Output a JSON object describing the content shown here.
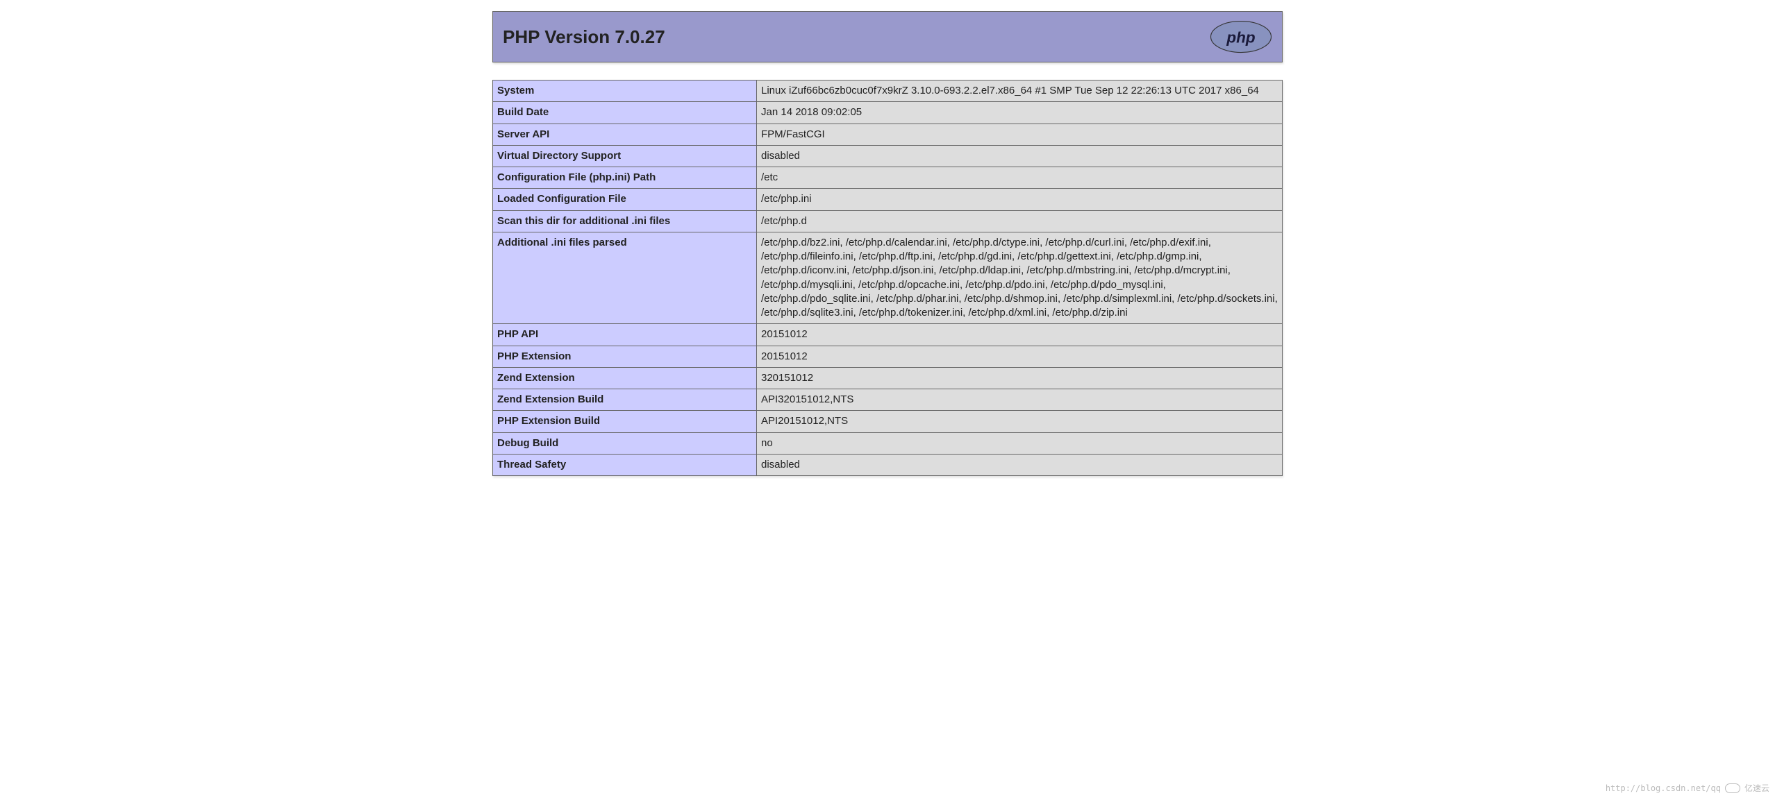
{
  "header": {
    "title": "PHP Version 7.0.27",
    "logo_text": "php"
  },
  "config_rows": [
    {
      "key": "System",
      "value": "Linux iZuf66bc6zb0cuc0f7x9krZ 3.10.0-693.2.2.el7.x86_64 #1 SMP Tue Sep 12 22:26:13 UTC 2017 x86_64"
    },
    {
      "key": "Build Date",
      "value": "Jan 14 2018 09:02:05"
    },
    {
      "key": "Server API",
      "value": "FPM/FastCGI"
    },
    {
      "key": "Virtual Directory Support",
      "value": "disabled"
    },
    {
      "key": "Configuration File (php.ini) Path",
      "value": "/etc"
    },
    {
      "key": "Loaded Configuration File",
      "value": "/etc/php.ini"
    },
    {
      "key": "Scan this dir for additional .ini files",
      "value": "/etc/php.d"
    },
    {
      "key": "Additional .ini files parsed",
      "value": "/etc/php.d/bz2.ini, /etc/php.d/calendar.ini, /etc/php.d/ctype.ini, /etc/php.d/curl.ini, /etc/php.d/exif.ini, /etc/php.d/fileinfo.ini, /etc/php.d/ftp.ini, /etc/php.d/gd.ini, /etc/php.d/gettext.ini, /etc/php.d/gmp.ini, /etc/php.d/iconv.ini, /etc/php.d/json.ini, /etc/php.d/ldap.ini, /etc/php.d/mbstring.ini, /etc/php.d/mcrypt.ini, /etc/php.d/mysqli.ini, /etc/php.d/opcache.ini, /etc/php.d/pdo.ini, /etc/php.d/pdo_mysql.ini, /etc/php.d/pdo_sqlite.ini, /etc/php.d/phar.ini, /etc/php.d/shmop.ini, /etc/php.d/simplexml.ini, /etc/php.d/sockets.ini, /etc/php.d/sqlite3.ini, /etc/php.d/tokenizer.ini, /etc/php.d/xml.ini, /etc/php.d/zip.ini"
    },
    {
      "key": "PHP API",
      "value": "20151012"
    },
    {
      "key": "PHP Extension",
      "value": "20151012"
    },
    {
      "key": "Zend Extension",
      "value": "320151012"
    },
    {
      "key": "Zend Extension Build",
      "value": "API320151012,NTS"
    },
    {
      "key": "PHP Extension Build",
      "value": "API20151012,NTS"
    },
    {
      "key": "Debug Build",
      "value": "no"
    },
    {
      "key": "Thread Safety",
      "value": "disabled"
    }
  ],
  "watermark": {
    "text": "http://blog.csdn.net/qq",
    "brand": "亿速云"
  }
}
